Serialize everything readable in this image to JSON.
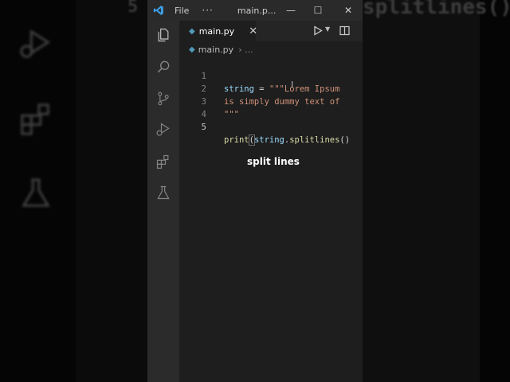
{
  "background": {
    "blur_line_number": "5",
    "blur_code_text": "splitlines()"
  },
  "titlebar": {
    "menu_file": "File",
    "more_label": "···",
    "title": "main.p...",
    "min_label": "—",
    "max_label": "☐",
    "close_label": "✕"
  },
  "activity_bar": {
    "items": [
      "explorer-icon",
      "search-icon",
      "source-control-icon",
      "run-debug-icon",
      "extensions-icon",
      "testing-icon"
    ]
  },
  "tabs": [
    {
      "label": "main.py",
      "close": "✕",
      "icon": "python-file-icon"
    }
  ],
  "breadcrumb": {
    "file": "main.py",
    "separator": "› ..."
  },
  "editor": {
    "lines": [
      {
        "num": "1",
        "var": "string",
        "op": " = ",
        "str": "\"\"\"Lorem Ipsum"
      },
      {
        "num": "2",
        "str": "is simply dummy text of"
      },
      {
        "num": "3",
        "str": "\"\"\""
      },
      {
        "num": "4"
      },
      {
        "num": "5",
        "fn": "print",
        "open": "(",
        "var": "string",
        "dot": ".",
        "method": "splitlines",
        "close": "()"
      }
    ]
  },
  "caption": "split lines",
  "colors": {
    "editor_bg": "#1e1e1e",
    "activity_bg": "#2b2b2b",
    "string": "#ce9178",
    "variable": "#9cdcfe",
    "function": "#dcdcaa",
    "vscode_blue": "#3d9ee9"
  }
}
